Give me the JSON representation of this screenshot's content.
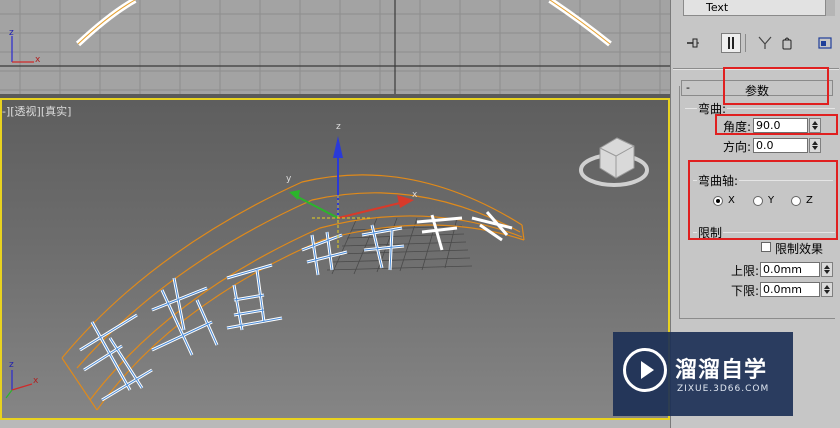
{
  "viewport_top": {
    "axis_x": "x",
    "axis_z": "z"
  },
  "viewport_persp": {
    "label": "-][透视][真实]",
    "gizmo": {
      "x": "x",
      "y": "y",
      "z": "z"
    },
    "corner_axis": {
      "x": "x",
      "z": "z"
    }
  },
  "modifier_list": {
    "selected": "Text"
  },
  "toolbar": {
    "pin_icon": "pin-icon",
    "show_end_icon": "show-end-result-icon",
    "make_unique_icon": "make-unique-icon",
    "remove_icon": "remove-modifier-icon",
    "configure_icon": "configure-modifier-sets-icon"
  },
  "rollout": {
    "collapse": "-",
    "title": "参数",
    "bend": {
      "group_label": "弯曲:",
      "angle_label": "角度:",
      "angle_value": "90.0",
      "direction_label": "方向:",
      "direction_value": "0.0"
    },
    "bend_axis": {
      "group_label": "弯曲轴:",
      "options": [
        "X",
        "Y",
        "Z"
      ],
      "selected": "X"
    },
    "limits": {
      "group_label": "限制",
      "limit_effect_label": "限制效果",
      "limit_effect_checked": false,
      "upper_label": "上限:",
      "upper_value": "0.0mm",
      "lower_label": "下限:",
      "lower_value": "0.0mm"
    }
  },
  "watermark": {
    "title": "溜溜自学",
    "url": "ZIXUE.3D66.COM"
  },
  "colors": {
    "viewport_border": "#e8d21f",
    "highlight": "#e02020",
    "wire_text": "#4a8bd8",
    "bounding": "#e08a1a"
  }
}
